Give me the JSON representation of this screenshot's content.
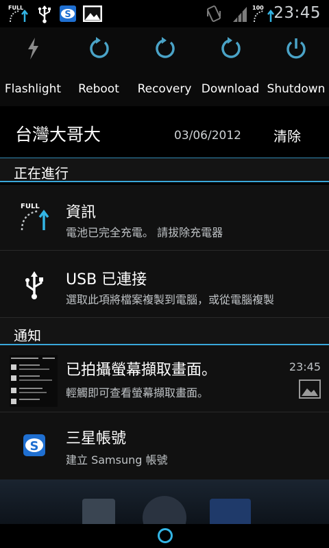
{
  "status_bar": {
    "left_icons": [
      "battery-full-icon",
      "usb-icon",
      "samsung-account-icon",
      "gallery-icon"
    ],
    "right_icons": [
      "vibrate-icon",
      "signal-icon",
      "battery-percent-icon"
    ],
    "battery_badge_left": "FULL",
    "battery_badge_right": "100",
    "time": "23:45"
  },
  "toggles": [
    {
      "label": "Flashlight",
      "icon": "flash-icon"
    },
    {
      "label": "Reboot",
      "icon": "reboot-icon"
    },
    {
      "label": "Recovery",
      "icon": "recovery-icon"
    },
    {
      "label": "Download",
      "icon": "download-icon"
    },
    {
      "label": "Shutdown",
      "icon": "power-icon"
    }
  ],
  "carrier": "台灣大哥大",
  "date": "03/06/2012",
  "clear_label": "清除",
  "sections": {
    "ongoing": "正在進行",
    "notifications": "通知"
  },
  "ongoing": [
    {
      "title": "資訊",
      "text": "電池已完全充電。 請拔除充電器",
      "icon": "battery-full-icon",
      "badge": "FULL"
    },
    {
      "title": "USB 已連接",
      "text": "選取此項將檔案複製到電腦，或從電腦複製",
      "icon": "usb-icon"
    }
  ],
  "notifications": [
    {
      "title": "已拍攝螢幕擷取畫面。",
      "text": "輕觸即可查看螢幕擷取畫面。",
      "time": "23:45",
      "icon": "screenshot-thumbnail"
    },
    {
      "title": "三星帳號",
      "text": "建立 Samsung 帳號",
      "icon": "samsung-account-icon"
    }
  ],
  "colors": {
    "accent": "#33b5e5",
    "toggle_icon": "#4aa3c7",
    "flash_icon": "#8c8c8c"
  }
}
